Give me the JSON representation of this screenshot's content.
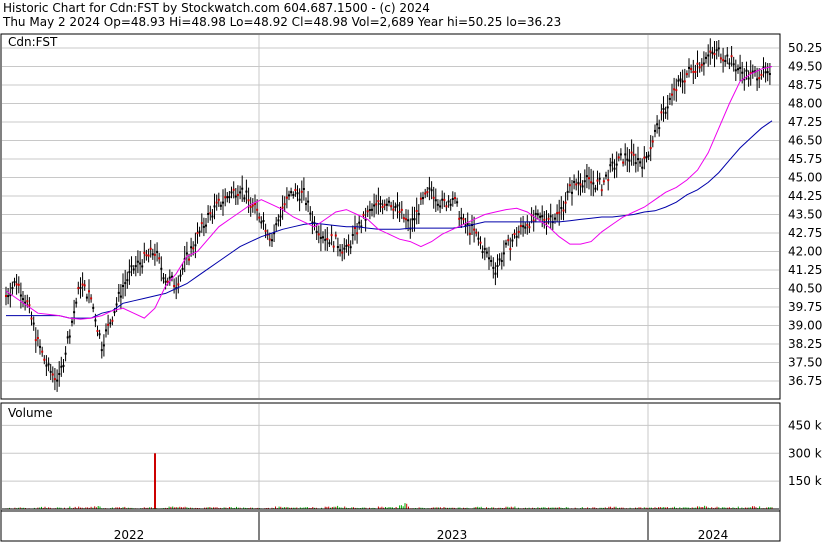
{
  "header": {
    "line1": "Historic Chart for Cdn:FST by Stockwatch.com 604.687.1500 - (c) 2024",
    "line2": "Thu May  2 2024   Op=48.93   Hi=48.98   Lo=48.92   Cl=48.98   Vol=2,689   Year hi=50.25   lo=36.23"
  },
  "chart_data": {
    "type": "line",
    "symbol_label": "Cdn:FST",
    "volume_label": "Volume",
    "price_ticks": [
      "50.25",
      "49.50",
      "48.75",
      "48.00",
      "47.25",
      "46.50",
      "45.75",
      "45.00",
      "44.25",
      "43.50",
      "42.75",
      "42.00",
      "41.25",
      "40.50",
      "39.75",
      "39.00",
      "38.25",
      "37.50",
      "36.75"
    ],
    "volume_ticks": [
      "450 k",
      "300 k",
      "150 k"
    ],
    "x_ticks": [
      "2022",
      "2023",
      "2024"
    ],
    "ylim": [
      36.3,
      50.7
    ],
    "volume_ylim": [
      0,
      560
    ],
    "colors": {
      "candle": "#000000",
      "down_dot": "#cc0000",
      "ma_short": "#ee00ee",
      "ma_long": "#0000aa",
      "vol_up": "#00aa00",
      "vol_down": "#cc0000",
      "grid": "#c8c8c8"
    },
    "series": [
      {
        "values": [
          40.4,
          40.1,
          39.8,
          39.5,
          39.45,
          39.4,
          39.3,
          39.25,
          39.3,
          39.4,
          39.6,
          39.7,
          39.5,
          39.3,
          39.7,
          40.6,
          41.1,
          41.8,
          42.0,
          42.5,
          43.0,
          43.3,
          43.6,
          43.9,
          44.1,
          43.9,
          43.7,
          43.4,
          43.2,
          43.0,
          43.3,
          43.6,
          43.7,
          43.5,
          43.3,
          42.9,
          42.7,
          42.5,
          42.4,
          42.2,
          42.4,
          42.7,
          42.9,
          43.1,
          43.3,
          43.5,
          43.6,
          43.7,
          43.75,
          43.6,
          43.3,
          43.0,
          42.6,
          42.3,
          42.3,
          42.4,
          42.8,
          43.1,
          43.4,
          43.6,
          43.8,
          44.1,
          44.4,
          44.6,
          44.9,
          45.3,
          46.0,
          47.0,
          48.0,
          48.9,
          49.2,
          49.4,
          49.5
        ]
      },
      {
        "values": [
          39.4,
          39.4,
          39.4,
          39.4,
          39.4,
          39.4,
          39.3,
          39.3,
          39.3,
          39.5,
          39.6,
          39.9,
          40.0,
          40.1,
          40.2,
          40.3,
          40.5,
          40.7,
          41.0,
          41.3,
          41.6,
          41.9,
          42.2,
          42.4,
          42.6,
          42.75,
          42.9,
          43.0,
          43.1,
          43.15,
          43.1,
          43.05,
          43.0,
          43.0,
          42.95,
          42.9,
          42.9,
          42.9,
          42.95,
          42.95,
          42.95,
          42.95,
          42.95,
          43.0,
          43.1,
          43.2,
          43.2,
          43.2,
          43.2,
          43.2,
          43.2,
          43.2,
          43.2,
          43.25,
          43.3,
          43.35,
          43.4,
          43.4,
          43.45,
          43.5,
          43.6,
          43.65,
          43.8,
          44.0,
          44.3,
          44.5,
          44.8,
          45.2,
          45.7,
          46.2,
          46.6,
          47.0,
          47.3
        ]
      },
      {
        "values": [
          40.2,
          40.8,
          39.9,
          38.3,
          37.2,
          36.8,
          38.8,
          40.7,
          40.1,
          38.2,
          39.4,
          40.6,
          41.3,
          41.7,
          42.0,
          40.9,
          40.7,
          41.7,
          42.6,
          43.4,
          43.9,
          44.3,
          44.6,
          43.9,
          43.4,
          42.5,
          43.8,
          44.4,
          44.3,
          43.1,
          42.6,
          42.4,
          42.0,
          42.9,
          43.5,
          43.9,
          44.1,
          43.6,
          43.0,
          43.9,
          44.5,
          43.9,
          44.2,
          43.1,
          42.8,
          42.0,
          41.3,
          42.1,
          42.7,
          43.2,
          43.3,
          43.4,
          43.5,
          44.5,
          44.9,
          44.8,
          44.7,
          45.4,
          45.8,
          45.8,
          45.6,
          46.8,
          47.8,
          48.6,
          49.2,
          49.6,
          49.9,
          50.1,
          49.8,
          49.3,
          49.1,
          49.3,
          48.9
        ]
      }
    ],
    "volume_spike": {
      "index": 15,
      "value": 300
    },
    "volume_baseline": [
      5,
      8,
      4,
      10,
      6,
      5,
      9,
      7,
      12,
      5,
      6,
      8,
      4,
      7,
      5,
      9,
      11,
      6,
      5,
      8,
      7,
      10,
      6,
      5,
      4,
      9,
      7,
      6,
      8,
      5,
      10,
      12,
      7,
      6,
      5,
      9,
      8,
      22,
      6,
      5,
      7,
      9,
      6,
      5,
      8,
      7,
      6,
      10,
      5,
      7,
      9,
      6,
      8,
      5,
      7,
      6,
      10,
      8,
      5,
      7,
      6,
      9,
      8,
      7,
      6,
      12,
      8,
      7,
      9,
      6,
      10,
      7,
      8
    ]
  }
}
